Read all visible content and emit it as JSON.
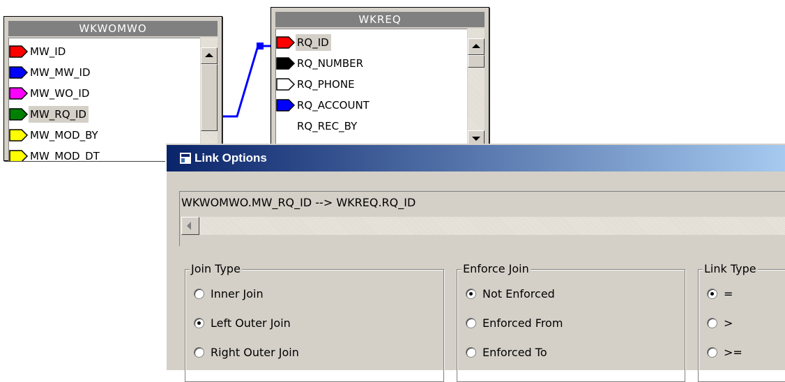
{
  "tables": {
    "left": {
      "title": "WKWOMWO",
      "fields": [
        {
          "name": "MW_ID",
          "color": "#ff0000"
        },
        {
          "name": "MW_MW_ID",
          "color": "#0000ff"
        },
        {
          "name": "MW_WO_ID",
          "color": "#ff00ff"
        },
        {
          "name": "MW_RQ_ID",
          "color": "#008000"
        },
        {
          "name": "MW_MOD_BY",
          "color": "#ffff00"
        },
        {
          "name": "MW_MOD_DT",
          "color": "#ffff00"
        }
      ]
    },
    "right": {
      "title": "WKREQ",
      "fields": [
        {
          "name": "RQ_ID",
          "color": "#ff0000"
        },
        {
          "name": "RQ_NUMBER",
          "color": "#000000"
        },
        {
          "name": "RQ_PHONE",
          "color": "#ffffff"
        },
        {
          "name": "RQ_ACCOUNT",
          "color": "#0000ff"
        },
        {
          "name": "RQ_REC_BY",
          "color": "none"
        }
      ]
    }
  },
  "link_color": "#0000ff",
  "dialog": {
    "title": "Link Options",
    "expression": "WKWOMWO.MW_RQ_ID --> WKREQ.RQ_ID",
    "groups": {
      "join_type": {
        "label": "Join Type",
        "options": [
          "Inner Join",
          "Left Outer Join",
          "Right Outer Join"
        ],
        "selected": "Left Outer Join"
      },
      "enforce_join": {
        "label": "Enforce Join",
        "options": [
          "Not Enforced",
          "Enforced From",
          "Enforced To"
        ],
        "selected": "Not Enforced"
      },
      "link_type": {
        "label": "Link Type",
        "options": [
          "=",
          ">",
          ">="
        ],
        "selected": "="
      }
    }
  },
  "icons": {
    "field_tag": "tag-arrow-icon",
    "dialog": "window-icon",
    "scroll_up": "arrow-up-icon",
    "scroll_down": "arrow-down-icon",
    "scroll_left": "arrow-left-icon"
  }
}
